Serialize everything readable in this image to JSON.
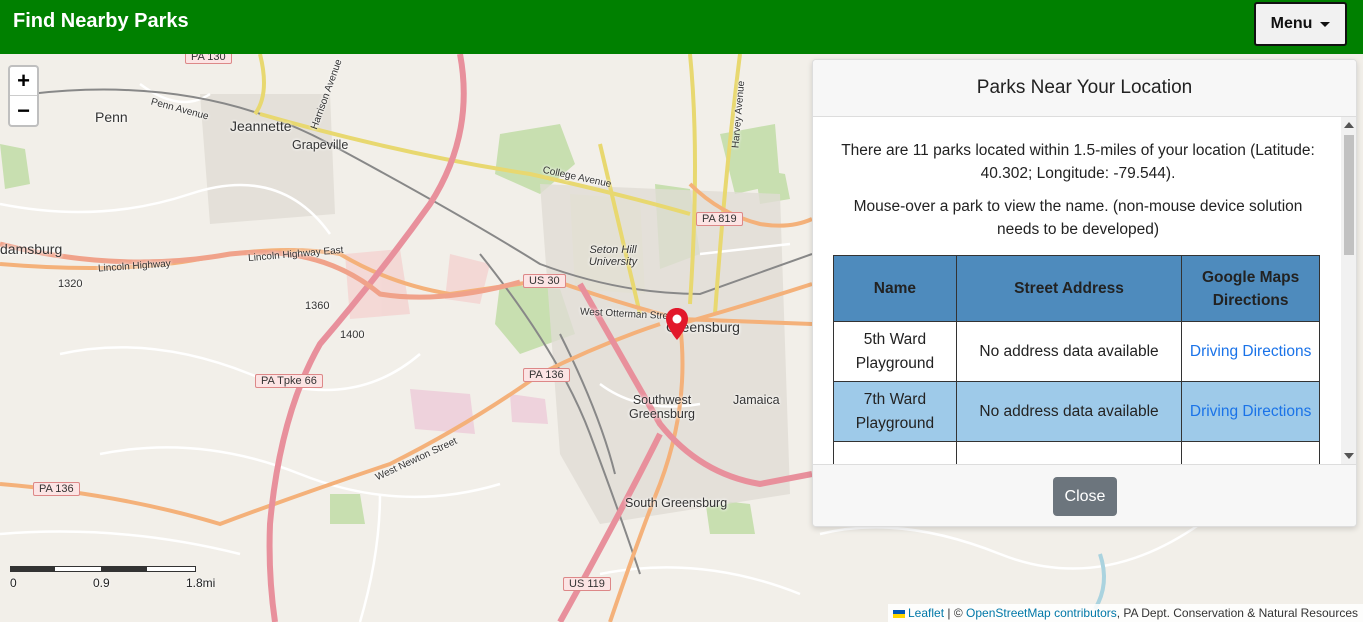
{
  "navbar": {
    "brand": "Find Nearby Parks",
    "menu_label": "Menu"
  },
  "map": {
    "zoom_in": "+",
    "zoom_out": "−",
    "labels": {
      "penn": "Penn",
      "jeannette": "Jeannette",
      "grapeville": "Grapeville",
      "adamsburg": "damsburg",
      "seton_hill": "Seton Hill University",
      "greensburg": "Greensburg",
      "southwest_greensburg": "Southwest Greensburg",
      "jamaica": "Jamaica",
      "south_greensburg": "South Greensburg",
      "lincoln_highway": "Lincoln Highway",
      "lincoln_highway_east": "Lincoln Highway East",
      "college_avenue": "College Avenue",
      "west_otterman_street": "West Otterman Street",
      "west_newton_street": "West Newton Street",
      "harrison_avenue": "Harrison Avenue",
      "harvey_avenue": "Harvey Avenue",
      "penn_avenue": "Penn Avenue",
      "elev_1320": "1320",
      "elev_1360": "1360",
      "elev_1400": "1400"
    },
    "shields": {
      "pa130": "PA 130",
      "us30": "US 30",
      "pa136_a": "PA 136",
      "pa136_b": "PA 136",
      "pa_tpke_66": "PA Tpke 66",
      "pa819": "PA 819",
      "us119": "US 119"
    },
    "scale": {
      "l0": "0",
      "l1": "0.9",
      "l2": "1.8mi"
    },
    "attribution": {
      "leaflet": "Leaflet",
      "sep": "| ©",
      "osm": "OpenStreetMap contributors",
      "rest": ", PA Dept. Conservation & Natural Resources"
    }
  },
  "panel": {
    "title": "Parks Near Your Location",
    "summary": "There are 11 parks located within 1.5-miles of your location (Latitude: 40.302; Longitude: -79.544).",
    "instructions": "Mouse-over a park to view the name. (non-mouse device solution needs to be developed)",
    "table": {
      "headers": [
        "Name",
        "Street Address",
        "Google Maps Directions"
      ],
      "rows": [
        {
          "name": "5th Ward Playground",
          "address": "No address data available",
          "link": "Driving Directions"
        },
        {
          "name": "7th Ward Playground",
          "address": "No address data available",
          "link": "Driving Directions"
        }
      ]
    },
    "close_label": "Close"
  },
  "colors": {
    "navbar": "#008000",
    "header_row": "#4e8bbd",
    "alt_row": "#9ecae9",
    "link": "#1a73e8",
    "motorway": "#e8909c"
  }
}
